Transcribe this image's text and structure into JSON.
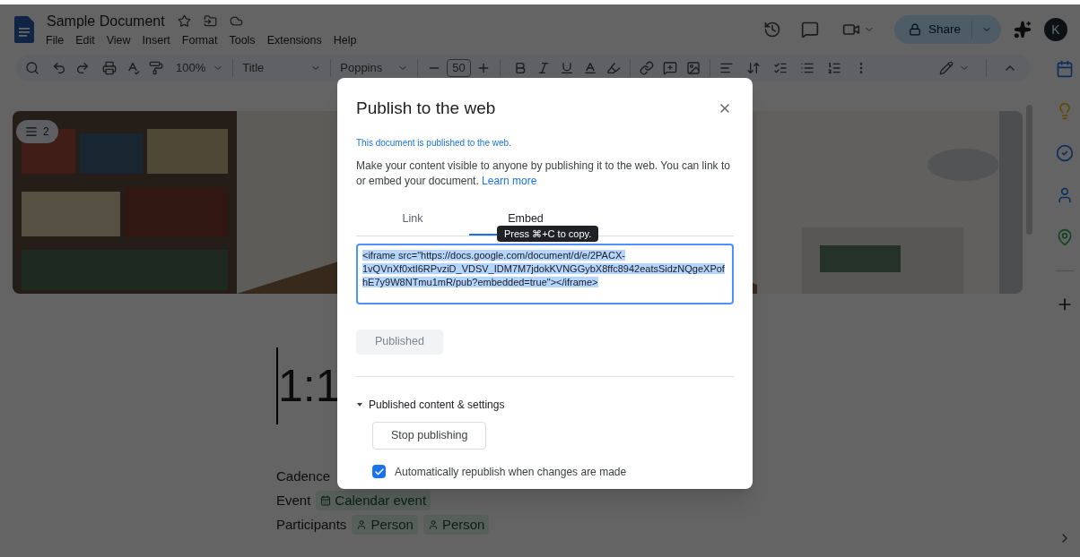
{
  "document": {
    "title": "Sample Document"
  },
  "menu": [
    "File",
    "Edit",
    "View",
    "Insert",
    "Format",
    "Tools",
    "Extensions",
    "Help"
  ],
  "toolbar": {
    "zoom": "100%",
    "style": "Title",
    "font": "Poppins",
    "font_size": "50"
  },
  "share": {
    "label": "Share"
  },
  "avatar": {
    "initial": "K"
  },
  "outline": {
    "count": "2"
  },
  "doc": {
    "heading": "1:1",
    "fields": [
      {
        "label": "Cadence"
      },
      {
        "label": "Event",
        "chips": [
          {
            "kind": "calendar",
            "text": "Calendar event"
          }
        ]
      },
      {
        "label": "Participants",
        "chips": [
          {
            "kind": "person",
            "text": "Person"
          },
          {
            "kind": "person",
            "text": "Person"
          }
        ]
      }
    ]
  },
  "dialog": {
    "title": "Publish to the web",
    "status": "This document is published to the web.",
    "description": "Make your content visible to anyone by publishing it to the web. You can link to or embed your document.",
    "learn_more": "Learn more",
    "tabs": [
      {
        "label": "Link",
        "selected": false
      },
      {
        "label": "Embed",
        "selected": true
      }
    ],
    "tooltip": "Press ⌘+C to copy.",
    "embed_code": "<iframe src=\"https://docs.google.com/document/d/e/2PACX-1vQVnXf0xtI6RPvziD_VDSV_IDM7M7jdokKVNGGybX8ffc8942eatsSidzNQgeXPofhE7y9W8NTmu1mR/pub?embedded=true\"></iframe>",
    "publish_button": {
      "label": "Published",
      "disabled": true
    },
    "settings": {
      "label": "Published content & settings",
      "expanded": true
    },
    "stop_button": "Stop publishing",
    "auto_republish": {
      "label": "Automatically republish when changes are made",
      "checked": true
    }
  }
}
